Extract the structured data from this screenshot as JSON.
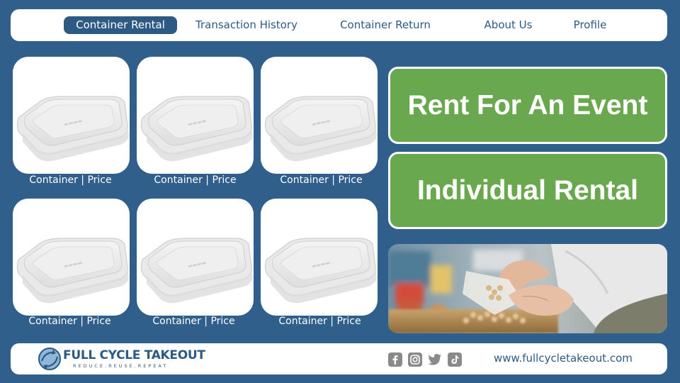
{
  "nav": {
    "items": [
      {
        "label": "Container Rental",
        "active": true
      },
      {
        "label": "Transaction History",
        "active": false
      },
      {
        "label": "Container Return",
        "active": false
      },
      {
        "label": "About Us",
        "active": false
      },
      {
        "label": "Profile",
        "active": false
      }
    ]
  },
  "products": [
    {
      "caption": "Container | Price",
      "icon": "plastic-container"
    },
    {
      "caption": "Container | Price",
      "icon": "plastic-container"
    },
    {
      "caption": "Container | Price",
      "icon": "plastic-container"
    },
    {
      "caption": "Container | Price",
      "icon": "plastic-container"
    },
    {
      "caption": "Container | Price",
      "icon": "plastic-container"
    },
    {
      "caption": "Container | Price",
      "icon": "plastic-container"
    }
  ],
  "actions": {
    "event_label": "Rent For An Event",
    "individual_label": "Individual Rental"
  },
  "footer": {
    "brand_name": "FULL CYCLE TAKEOUT",
    "brand_tagline": "REDUCE.REUSE.REPEAT",
    "social": [
      "facebook",
      "instagram",
      "twitter",
      "tiktok"
    ],
    "website": "www.fullcycletakeout.com"
  },
  "colors": {
    "background": "#2f5f8a",
    "accent": "#2d5a82",
    "green": "#6aa84f"
  }
}
